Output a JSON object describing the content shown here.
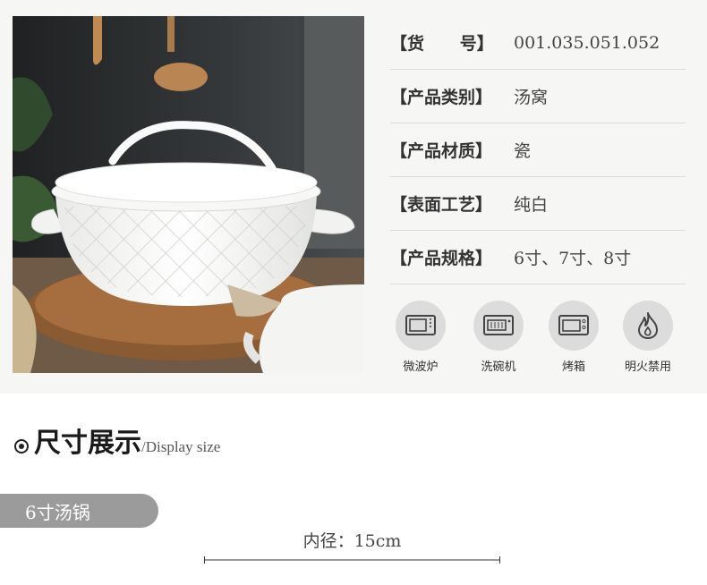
{
  "specs": [
    {
      "label": "【货      号】",
      "value": "001.035.051.052"
    },
    {
      "label": "【产品类别】",
      "value": "汤窝"
    },
    {
      "label": "【产品材质】",
      "value": "瓷"
    },
    {
      "label": "【表面工艺】",
      "value": "纯白"
    },
    {
      "label": "【产品规格】",
      "value": "6寸、7寸、8寸"
    }
  ],
  "usage_icons": [
    {
      "icon": "microwave-icon",
      "label": "微波炉"
    },
    {
      "icon": "dishwasher-icon",
      "label": "洗碗机"
    },
    {
      "icon": "oven-icon",
      "label": "烤箱"
    },
    {
      "icon": "flame-icon",
      "label": "明火禁用"
    }
  ],
  "section": {
    "title_cn": "尺寸展示",
    "title_en": "/Display size"
  },
  "size_tab": "6寸汤锅",
  "dimension": "内径：15cm",
  "colors": {
    "background_top": "#f6f6f4",
    "icon_circle": "#dcdcdc",
    "tab": "#9b9b9b"
  }
}
